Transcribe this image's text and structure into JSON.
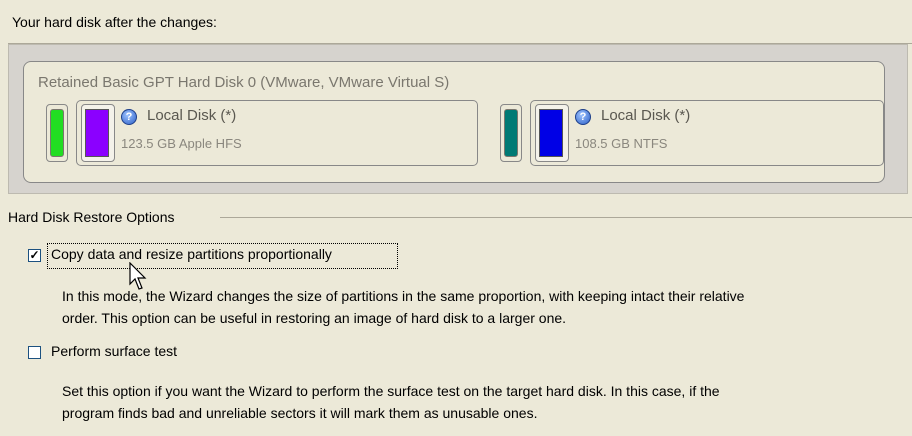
{
  "header": {
    "label": "Your hard disk after the changes:"
  },
  "disk": {
    "title": "Retained Basic GPT Hard Disk 0 (VMware, VMware Virtual S)",
    "partitions": [
      {
        "name": "Local Disk (*)",
        "size": "123.5 GB Apple HFS",
        "color": "#8b00ff"
      },
      {
        "name": "Local Disk (*)",
        "size": "108.5 GB NTFS",
        "color": "#0000e6"
      }
    ],
    "small_parts": [
      {
        "color": "#22dd22"
      },
      {
        "color": "#007a74"
      }
    ]
  },
  "options": {
    "section_label": "Hard Disk Restore Options",
    "copy": {
      "checked": true,
      "label": "Copy data and resize partitions proportionally",
      "description_line1": "In this mode, the Wizard changes the size of partitions in the same proportion, with keeping intact their relative",
      "description_line2": "order. This option can be useful in restoring an image of hard disk to a larger one."
    },
    "surface": {
      "checked": false,
      "label": "Perform surface test",
      "description_line1": "Set this option if you want the Wizard to perform the surface test on the target hard disk. In this case, if the",
      "description_line2": "program finds bad and unreliable sectors it will mark them as unusable ones."
    }
  }
}
